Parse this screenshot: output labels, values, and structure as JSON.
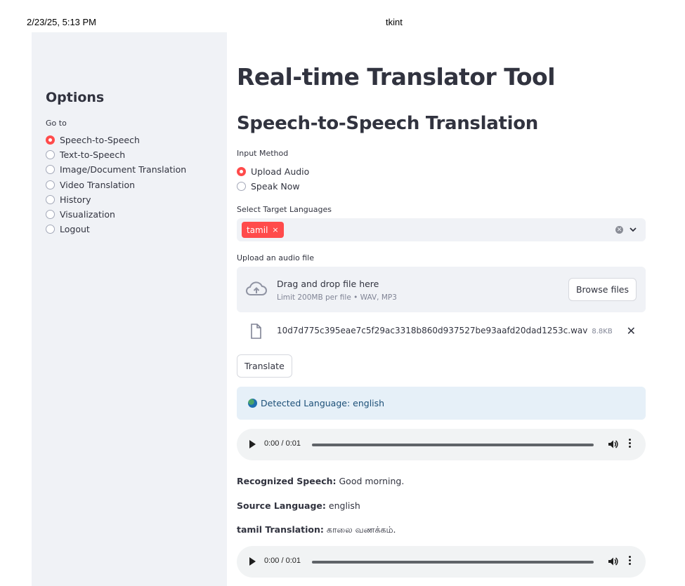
{
  "print_header": {
    "date": "2/23/25, 5:13 PM",
    "title": "tkint"
  },
  "sidebar": {
    "heading": "Options",
    "goto_label": "Go to",
    "items": [
      {
        "label": "Speech-to-Speech",
        "selected": true
      },
      {
        "label": "Text-to-Speech",
        "selected": false
      },
      {
        "label": "Image/Document Translation",
        "selected": false
      },
      {
        "label": "Video Translation",
        "selected": false
      },
      {
        "label": "History",
        "selected": false
      },
      {
        "label": "Visualization",
        "selected": false
      },
      {
        "label": "Logout",
        "selected": false
      }
    ]
  },
  "main": {
    "title": "Real-time Translator Tool",
    "subtitle": "Speech-to-Speech Translation",
    "input_method": {
      "label": "Input Method",
      "options": [
        {
          "label": "Upload Audio",
          "selected": true
        },
        {
          "label": "Speak Now",
          "selected": false
        }
      ]
    },
    "target_languages": {
      "label": "Select Target Languages",
      "selected": [
        "tamil"
      ],
      "tag_remove": "×"
    },
    "upload": {
      "label": "Upload an audio file",
      "drop_text": "Drag and drop file here",
      "limit_text": "Limit 200MB per file • WAV, MP3",
      "browse_label": "Browse files",
      "file": {
        "name": "10d7d775c395eae7c5f29ac3318b860d937527be93aafd20dad1253c.wav",
        "size": "8.8KB"
      }
    },
    "translate_label": "Translate",
    "detected": "Detected Language: english",
    "audio_players": [
      {
        "time": "0:00 / 0:01"
      },
      {
        "time": "0:00 / 0:01"
      }
    ],
    "results": {
      "recognized_label": "Recognized Speech:",
      "recognized_value": "Good morning.",
      "source_label": "Source Language:",
      "source_value": "english",
      "translation_label": "tamil Translation:",
      "translation_value": "காலை வணக்கம்."
    }
  },
  "colors": {
    "accent": "#ff4b4b",
    "sidebar_bg": "#f0f2f6",
    "info_bg": "#e6f0f8",
    "text": "#31333f"
  }
}
